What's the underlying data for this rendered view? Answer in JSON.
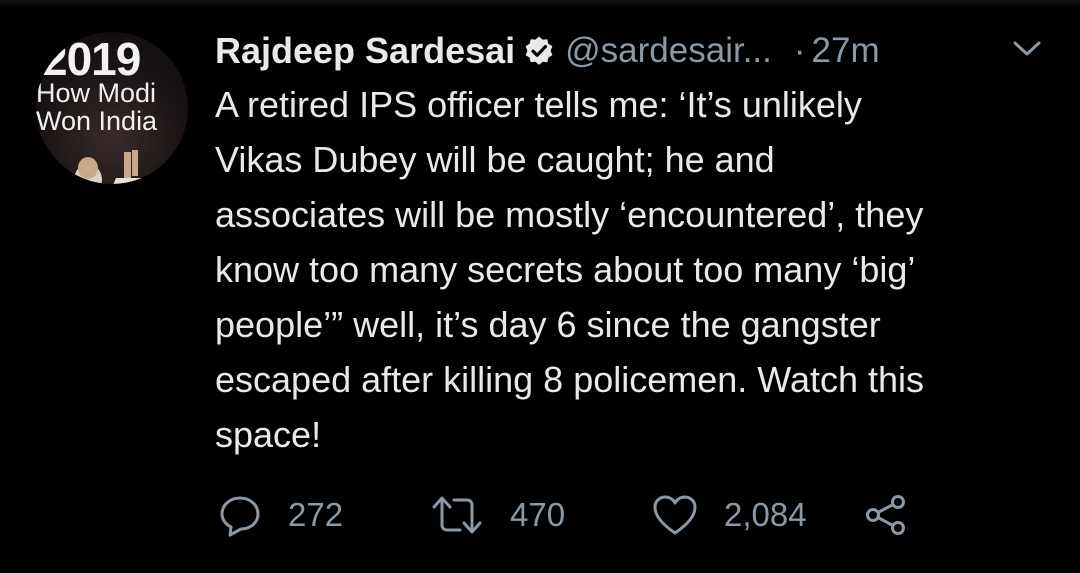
{
  "avatar": {
    "year": "2019",
    "line1": "How Modi",
    "line2": "Won India"
  },
  "tweet": {
    "author_name": "Rajdeep Sardesai",
    "handle": "@sardesair...",
    "separator": "·",
    "time": "27m",
    "text": "A retired IPS officer tells me: ‘It’s unlikely\nVikas Dubey will be caught; he and\nassociates will be mostly ‘encountered’, they\nknow too many secrets about too many ‘big’\npeople’” well, it’s day 6 since the gangster\nescaped after killing 8 policemen. Watch this\nspace!"
  },
  "actions": {
    "replies": "272",
    "retweets": "470",
    "likes": "2,084"
  },
  "icons": {
    "verified": "verified-badge-icon",
    "caret": "chevron-down-icon",
    "reply": "comment-icon",
    "retweet": "retweet-icon",
    "like": "heart-icon",
    "share": "share-icon"
  },
  "colors": {
    "background": "#000000",
    "text": "#e7e9ea",
    "secondary": "#8b98a5"
  }
}
